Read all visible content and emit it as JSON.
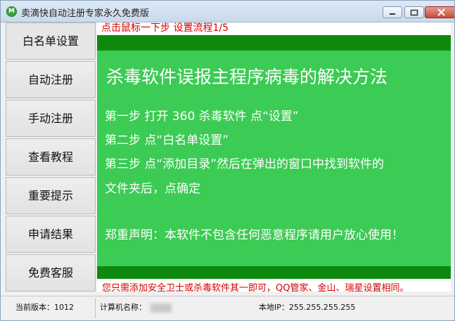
{
  "window": {
    "title": "卖滴快自动注册专家永久免费版",
    "icon_letter": "M"
  },
  "sidebar": {
    "items": [
      {
        "label": "白名单设置"
      },
      {
        "label": "自动注册"
      },
      {
        "label": "手动注册"
      },
      {
        "label": "查看教程"
      },
      {
        "label": "重要提示"
      },
      {
        "label": "申请结果"
      },
      {
        "label": "免费客服"
      }
    ]
  },
  "content": {
    "step_hint": "点击鼠标一下步  设置流程1/5",
    "heading": "杀毒软件误报主程序病毒的解决方法",
    "lines": [
      "第一步 打开 360 杀毒软件 点“设置”",
      "第二步 点“白名单设置”",
      "第三步 点“添加目录”然后在弹出的窗口中找到软件的",
      "文件夹后，点确定",
      "郑重声明：本软件不包含任何恶意程序请用户放心使用！"
    ],
    "bottom_note": "您只需添加安全卫士或杀毒软件其一即可，QQ管家、金山、瑞星设置相同。",
    "colors": {
      "panel_green": "#3ccb54",
      "bar_green": "#0d8a0d",
      "hint_red": "#d40000"
    }
  },
  "status": {
    "version": "当前版本：1012",
    "computer_name_label": "计算机名称：",
    "local_ip": "本地IP：255.255.255.255"
  }
}
